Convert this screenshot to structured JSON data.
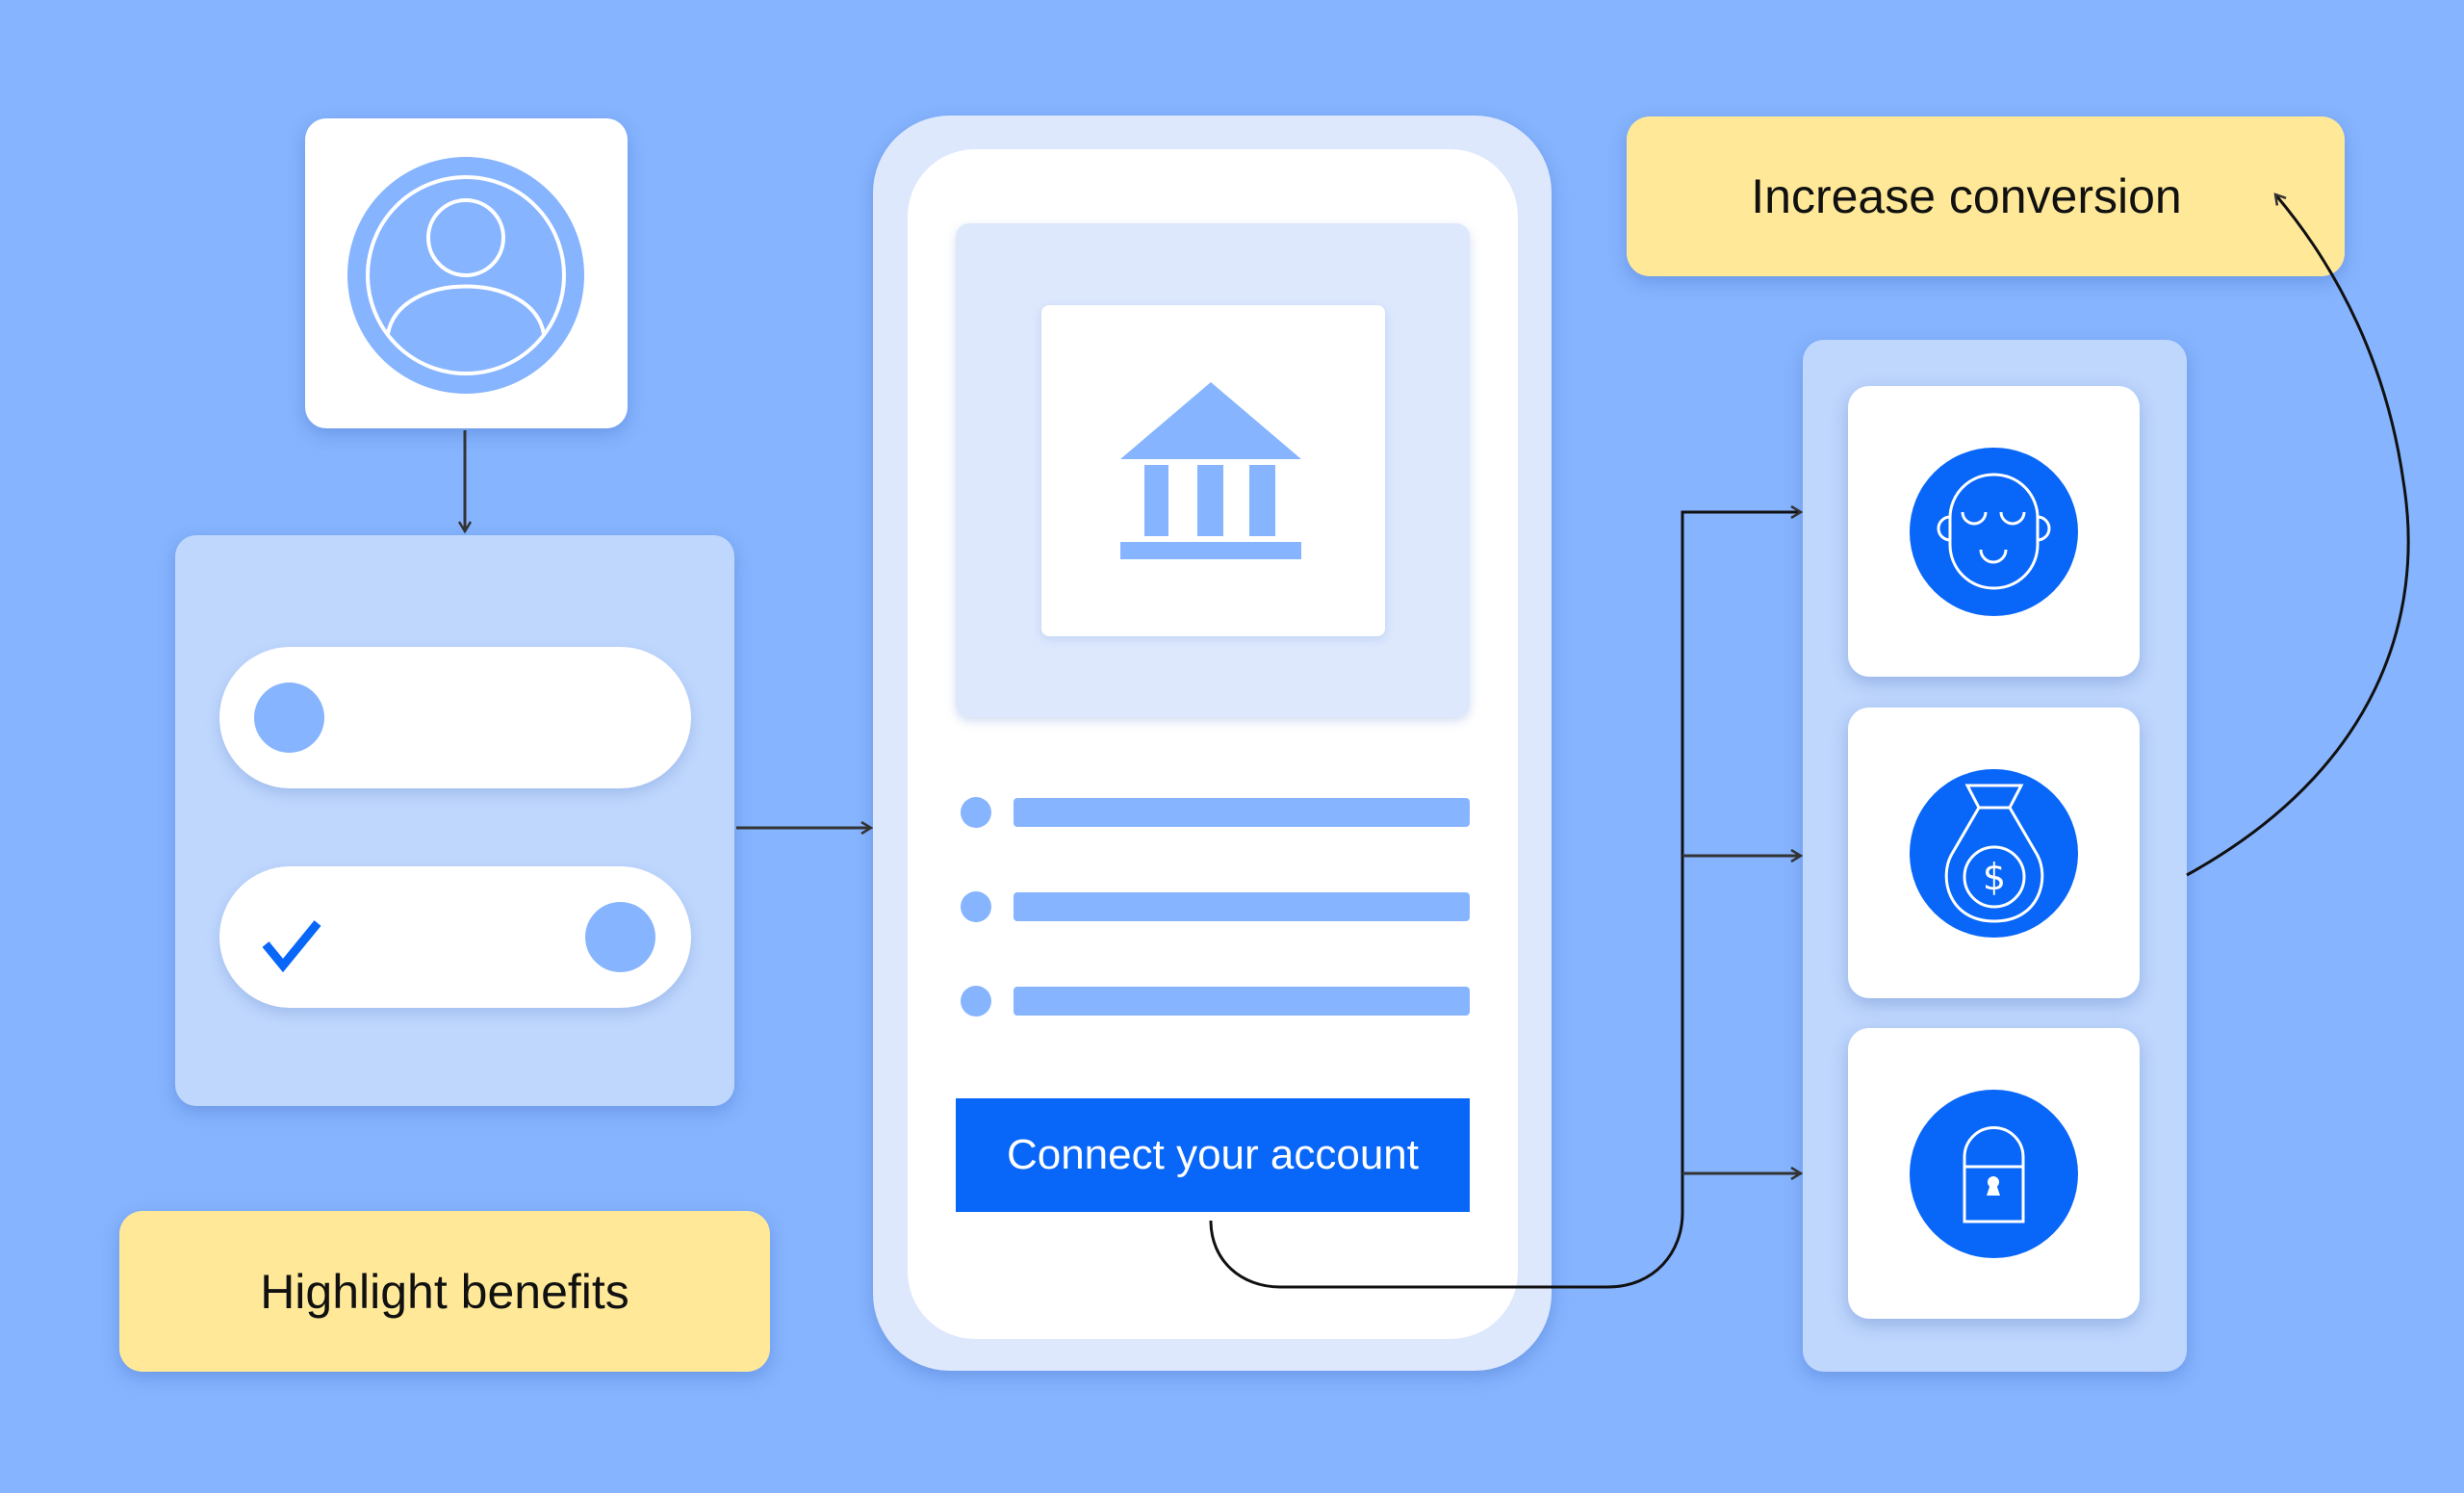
{
  "flow": {
    "step_labels": {
      "highlight_benefits": "Highlight benefits",
      "increase_conversion": "Increase conversion"
    },
    "avatar": {
      "icon": "user-profile-icon"
    },
    "toggles": [
      {
        "state": "off",
        "icon": ""
      },
      {
        "state": "on",
        "icon": "checkmark-icon"
      }
    ],
    "phone": {
      "bank_icon": "bank-icon",
      "list_items": 3,
      "cta_label": "Connect your account"
    },
    "benefits": [
      {
        "icon": "relaxed-face-icon"
      },
      {
        "icon": "money-bag-icon"
      },
      {
        "icon": "padlock-icon"
      }
    ]
  },
  "colors": {
    "background": "#86b4fe",
    "panel": "#bfd7fd",
    "phone_frame": "#dde8fd",
    "accent": "#0866f8",
    "label_yellow": "#ffe999"
  }
}
